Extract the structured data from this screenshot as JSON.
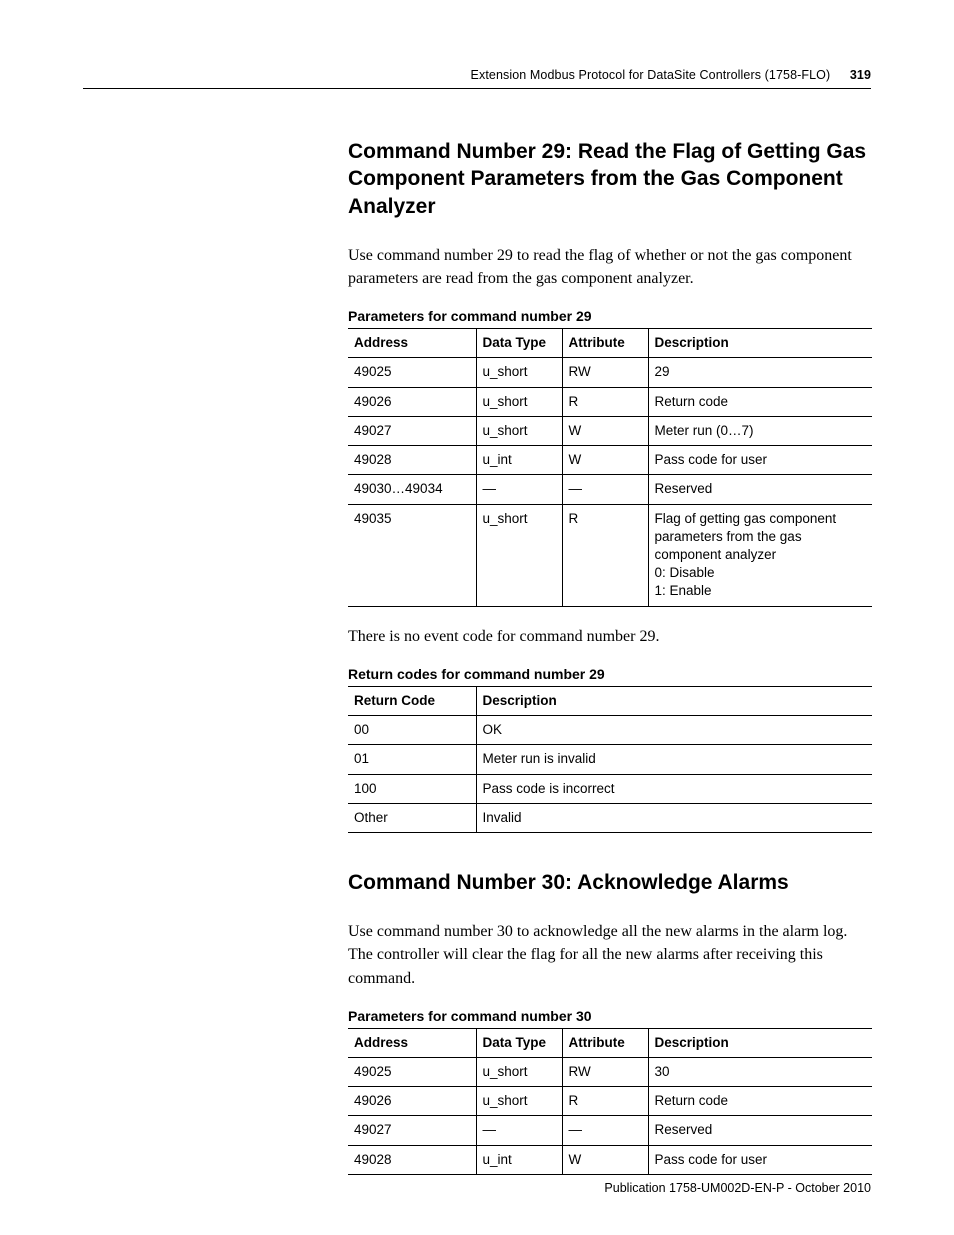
{
  "header": {
    "running_title": "Extension Modbus Protocol for DataSite Controllers (1758-FLO)",
    "page_number": "319"
  },
  "sections": [
    {
      "title": "Command Number 29: Read the Flag of Getting Gas Component Parameters from the Gas Component Analyzer",
      "intro": "Use command number 29 to read the flag of whether or not the gas component parameters are read from the gas component analyzer.",
      "params_caption": "Parameters for command number 29",
      "params_headers": {
        "address": "Address",
        "datatype": "Data Type",
        "attribute": "Attribute",
        "description": "Description"
      },
      "params_rows": [
        {
          "address": "49025",
          "datatype": "u_short",
          "attribute": "RW",
          "description": "29"
        },
        {
          "address": "49026",
          "datatype": "u_short",
          "attribute": "R",
          "description": "Return code"
        },
        {
          "address": "49027",
          "datatype": "u_short",
          "attribute": "W",
          "description": "Meter run (0…7)"
        },
        {
          "address": "49028",
          "datatype": "u_int",
          "attribute": "W",
          "description": "Pass code for user"
        },
        {
          "address": "49030…49034",
          "datatype": "—",
          "attribute": "—",
          "description": "Reserved"
        },
        {
          "address": "49035",
          "datatype": "u_short",
          "attribute": "R",
          "description": "Flag of getting gas component parameters from the gas component analyzer\n0: Disable\n1: Enable"
        }
      ],
      "after_params_note": "There is no event code for command number 29.",
      "retcodes_caption": "Return codes for command number 29",
      "retcodes_headers": {
        "code": "Return Code",
        "description": "Description"
      },
      "retcodes_rows": [
        {
          "code": "00",
          "description": "OK"
        },
        {
          "code": "01",
          "description": "Meter run is invalid"
        },
        {
          "code": "100",
          "description": "Pass code is incorrect"
        },
        {
          "code": "Other",
          "description": "Invalid"
        }
      ]
    },
    {
      "title": "Command Number 30: Acknowledge Alarms",
      "intro": "Use command number 30 to acknowledge all the new alarms in the alarm log. The controller will clear the flag for all the new alarms after receiving this command.",
      "params_caption": "Parameters for command number 30",
      "params_headers": {
        "address": "Address",
        "datatype": "Data Type",
        "attribute": "Attribute",
        "description": "Description"
      },
      "params_rows": [
        {
          "address": "49025",
          "datatype": "u_short",
          "attribute": "RW",
          "description": "30"
        },
        {
          "address": "49026",
          "datatype": "u_short",
          "attribute": "R",
          "description": "Return code"
        },
        {
          "address": "49027",
          "datatype": "—",
          "attribute": "—",
          "description": "Reserved"
        },
        {
          "address": "49028",
          "datatype": "u_int",
          "attribute": "W",
          "description": "Pass code for user"
        }
      ]
    }
  ],
  "footer": {
    "publication": "Publication 1758-UM002D-EN-P - October 2010"
  }
}
